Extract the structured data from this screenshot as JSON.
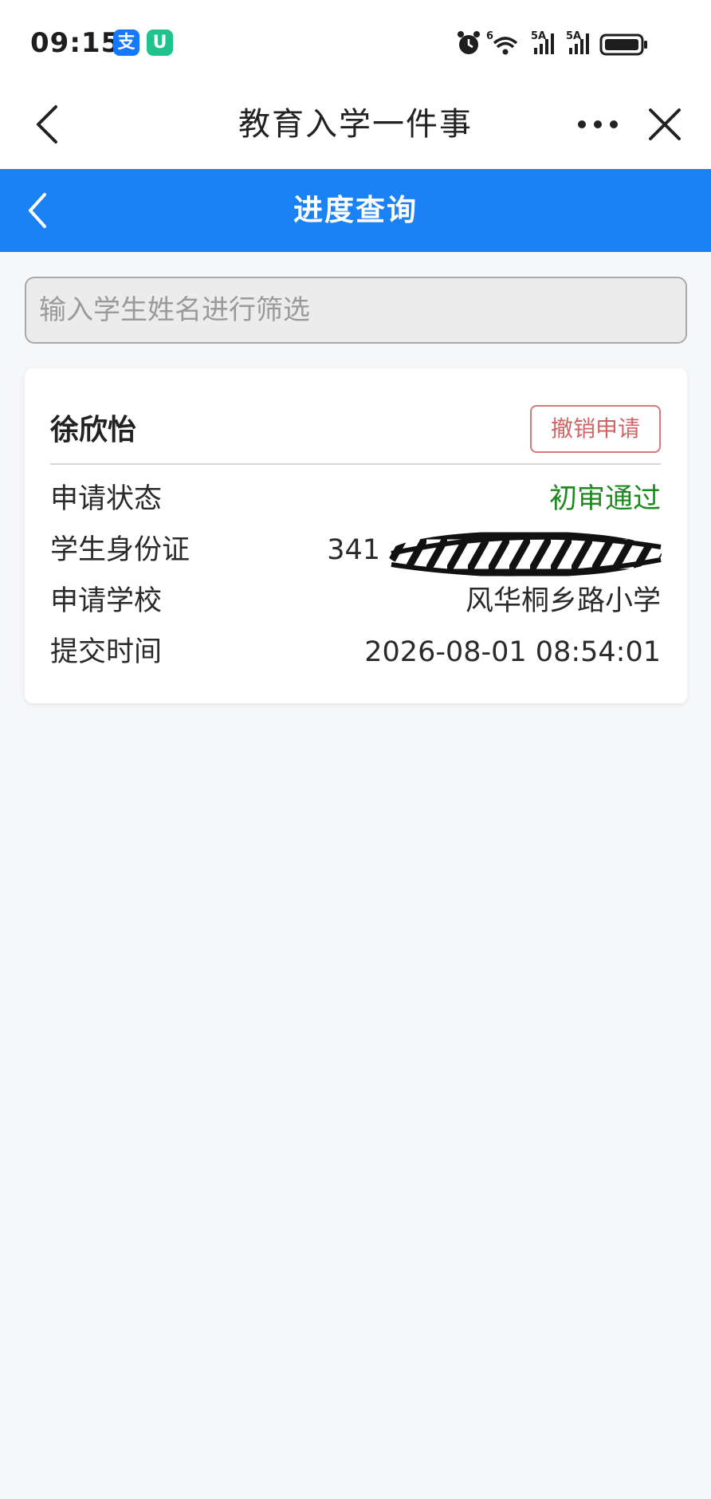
{
  "status_bar": {
    "time": "09:15",
    "badge_alipay": "支",
    "badge_green": "U",
    "wifi_label": "6",
    "signal1_label": "5A",
    "signal2_label": "5A"
  },
  "nav": {
    "title": "教育入学一件事"
  },
  "header": {
    "title": "进度查询"
  },
  "search": {
    "placeholder": "输入学生姓名进行筛选"
  },
  "application": {
    "student_name": "徐欣怡",
    "cancel_label": "撤销申请",
    "rows": [
      {
        "label": "申请状态",
        "value": "初审通过"
      },
      {
        "label": "学生身份证",
        "value": "341"
      },
      {
        "label": "申请学校",
        "value": "风华桐乡路小学"
      },
      {
        "label": "提交时间",
        "value": "2026-08-01 08:54:01"
      }
    ]
  },
  "colors": {
    "header_blue": "#1b82f6",
    "status_green": "#1f8a1f",
    "cancel_red": "#d06565"
  }
}
